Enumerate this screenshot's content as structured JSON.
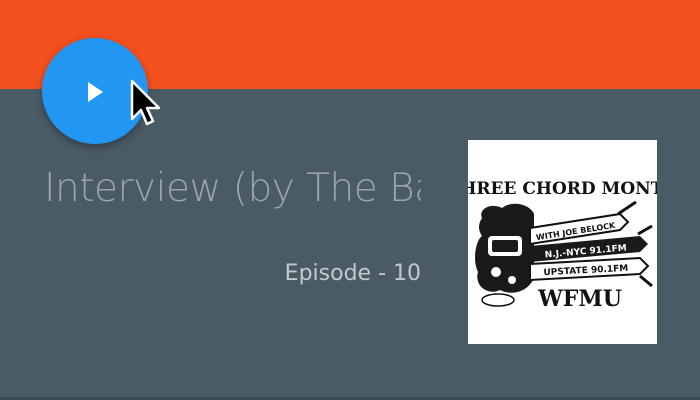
{
  "colors": {
    "header": "#f4511e",
    "background": "#4b5b66",
    "play_button": "#2196f3",
    "title_text": "#9aa4ab",
    "subtitle_text": "#c3c9cd"
  },
  "player": {
    "play_icon": "play-icon",
    "cursor_icon": "mouse-pointer-icon"
  },
  "episode": {
    "title": "Interview (by The Ba",
    "subtitle": "Episode - 10"
  },
  "artwork": {
    "logo_top": "THREE CHORD MONTE",
    "with_line": "WITH JOE BELOCK",
    "freq_line_1": "N.J.-NYC 91.1FM",
    "freq_line_2": "UPSTATE 90.1FM",
    "station": "WFMU"
  }
}
